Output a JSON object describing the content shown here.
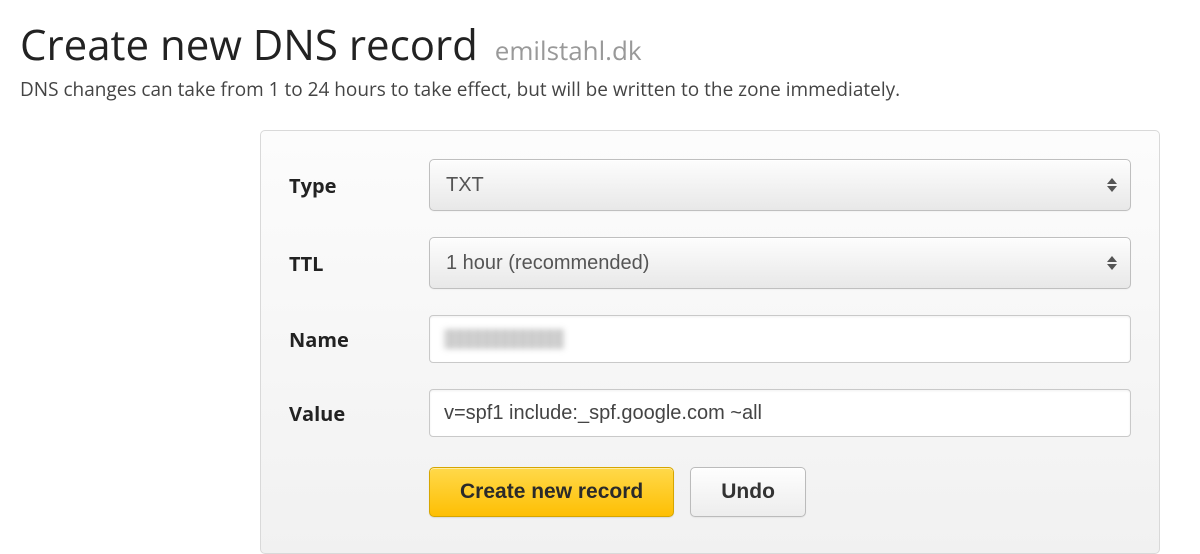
{
  "header": {
    "title": "Create new DNS record",
    "domain": "emilstahl.dk",
    "description": "DNS changes can take from 1 to 24 hours to take effect, but will be written to the zone immediately."
  },
  "form": {
    "type": {
      "label": "Type",
      "selected": "TXT"
    },
    "ttl": {
      "label": "TTL",
      "selected": "1 hour (recommended)"
    },
    "name": {
      "label": "Name",
      "value": "(redacted)"
    },
    "value": {
      "label": "Value",
      "value": "v=spf1 include:_spf.google.com ~all"
    },
    "buttons": {
      "submit": "Create new record",
      "undo": "Undo"
    }
  }
}
